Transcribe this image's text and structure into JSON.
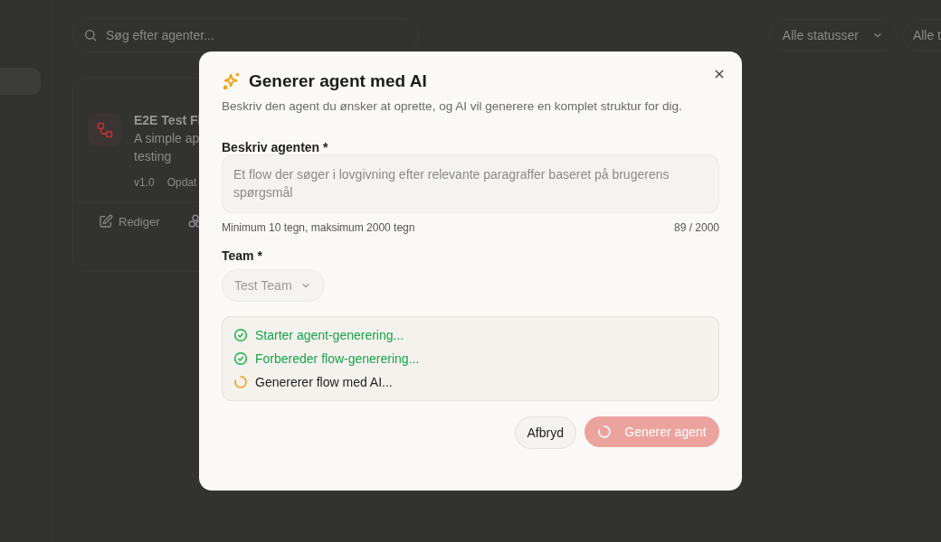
{
  "page": {
    "search": {
      "placeholder": "Søg efter agenter..."
    },
    "filters": [
      {
        "label": "Alle statusser"
      },
      {
        "label": "Alle t"
      }
    ],
    "card": {
      "title": "E2E Test Fl",
      "description_lines": [
        "A simple ap",
        "testing"
      ],
      "meta": [
        "v1.0",
        "Opdat"
      ],
      "actions": [
        {
          "label": "Rediger",
          "kind": "edit"
        },
        {
          "kind": "group"
        }
      ]
    }
  },
  "dialog": {
    "title": "Generer agent med AI",
    "subtitle": "Beskriv den agent du ønsker at oprette, og AI vil generere en komplet struktur for dig.",
    "description": {
      "label": "Beskriv agenten *",
      "value": "Et flow der søger i lovgivning efter relevante paragraffer baseret på brugerens spørgsmål",
      "disabled": true,
      "hint": "Minimum 10 tegn, maksimum 2000 tegn",
      "count": "89 / 2000"
    },
    "team": {
      "label": "Team *",
      "value": "Test Team",
      "disabled": true
    },
    "steps": [
      {
        "label": "Starter agent-generering...",
        "done": true
      },
      {
        "label": "Forbereder flow-generering...",
        "done": true
      },
      {
        "label": "Genererer flow med AI...",
        "done": false
      }
    ],
    "cancel": {
      "label": "Afbryd"
    },
    "submit": {
      "label": "Generer agent",
      "loading": true,
      "disabled": true
    }
  }
}
